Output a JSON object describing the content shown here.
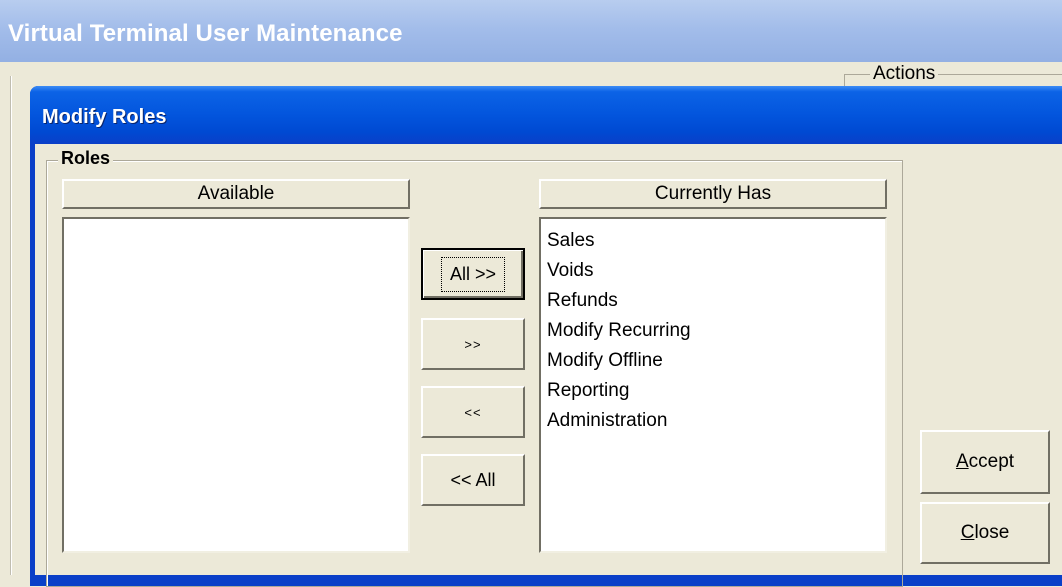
{
  "outer_window": {
    "title": "Virtual Terminal User Maintenance",
    "actions_group_label": "Actions"
  },
  "dialog": {
    "title": "Modify Roles",
    "roles_group_label": "Roles",
    "available": {
      "header": "Available",
      "items": []
    },
    "currently_has": {
      "header": "Currently Has",
      "items": [
        "Sales",
        "Voids",
        "Refunds",
        "Modify Recurring",
        "Modify Offline",
        "Reporting",
        "Administration"
      ]
    },
    "buttons": {
      "add_all": "All >>",
      "add": ">>",
      "remove": "<<",
      "remove_all": "<< All",
      "accept_mnemonic": "A",
      "accept_rest": "ccept",
      "close_mnemonic": "C",
      "close_rest": "lose"
    }
  },
  "colors": {
    "dialog_title_bar": "#0355dd",
    "outer_title_bar": "#a3bdea",
    "face": "#ece9d8"
  }
}
